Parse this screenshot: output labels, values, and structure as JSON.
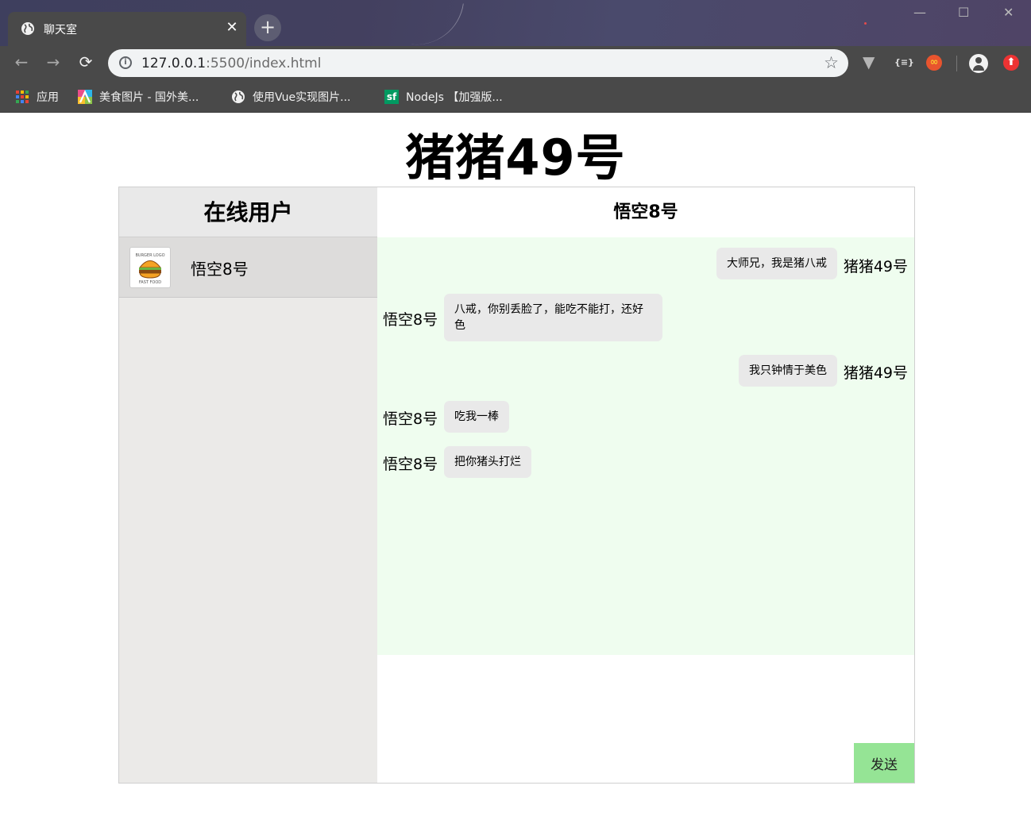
{
  "browser": {
    "tab_title": "聊天室",
    "tab_close": "✕",
    "new_tab": "+",
    "url_host": "127.0.0.1",
    "url_rest": ":5500/index.html",
    "back_icon": "←",
    "forward_icon": "→",
    "reload_icon": "⟳",
    "star_icon": "☆",
    "minimize": "—",
    "maximize": "☐",
    "close": "✕",
    "extensions": {
      "vue": "▼",
      "json": "{≡}",
      "infinity": "∞",
      "upload": "⬆"
    },
    "bookmarks": [
      {
        "label": "应用"
      },
      {
        "label": "美食图片 - 国外美..."
      },
      {
        "label": "使用Vue实现图片..."
      },
      {
        "label": "NodeJs 【加强版..."
      }
    ],
    "sf_icon_text": "sf"
  },
  "page": {
    "title": "猪猪49号"
  },
  "sidebar": {
    "heading": "在线用户",
    "users": [
      {
        "name": "悟空8号",
        "avatar_icon": "burger-logo-icon"
      }
    ]
  },
  "chat": {
    "heading": "悟空8号",
    "messages": [
      {
        "sender": "猪猪49号",
        "text": "大师兄，我是猪八戒",
        "side": "right"
      },
      {
        "sender": "悟空8号",
        "text": "八戒，你别丢脸了，能吃不能打，还好色",
        "side": "left"
      },
      {
        "sender": "猪猪49号",
        "text": "我只钟情于美色",
        "side": "right"
      },
      {
        "sender": "悟空8号",
        "text": "吃我一棒",
        "side": "left"
      },
      {
        "sender": "悟空8号",
        "text": "把你猪头打烂",
        "side": "left"
      }
    ],
    "input_value": "",
    "send_label": "发送"
  },
  "colors": {
    "messages_bg": "#effdef",
    "bubble_bg": "#e9e9e9",
    "send_button": "#95e495",
    "sidebar_bg": "#ebeae8"
  }
}
